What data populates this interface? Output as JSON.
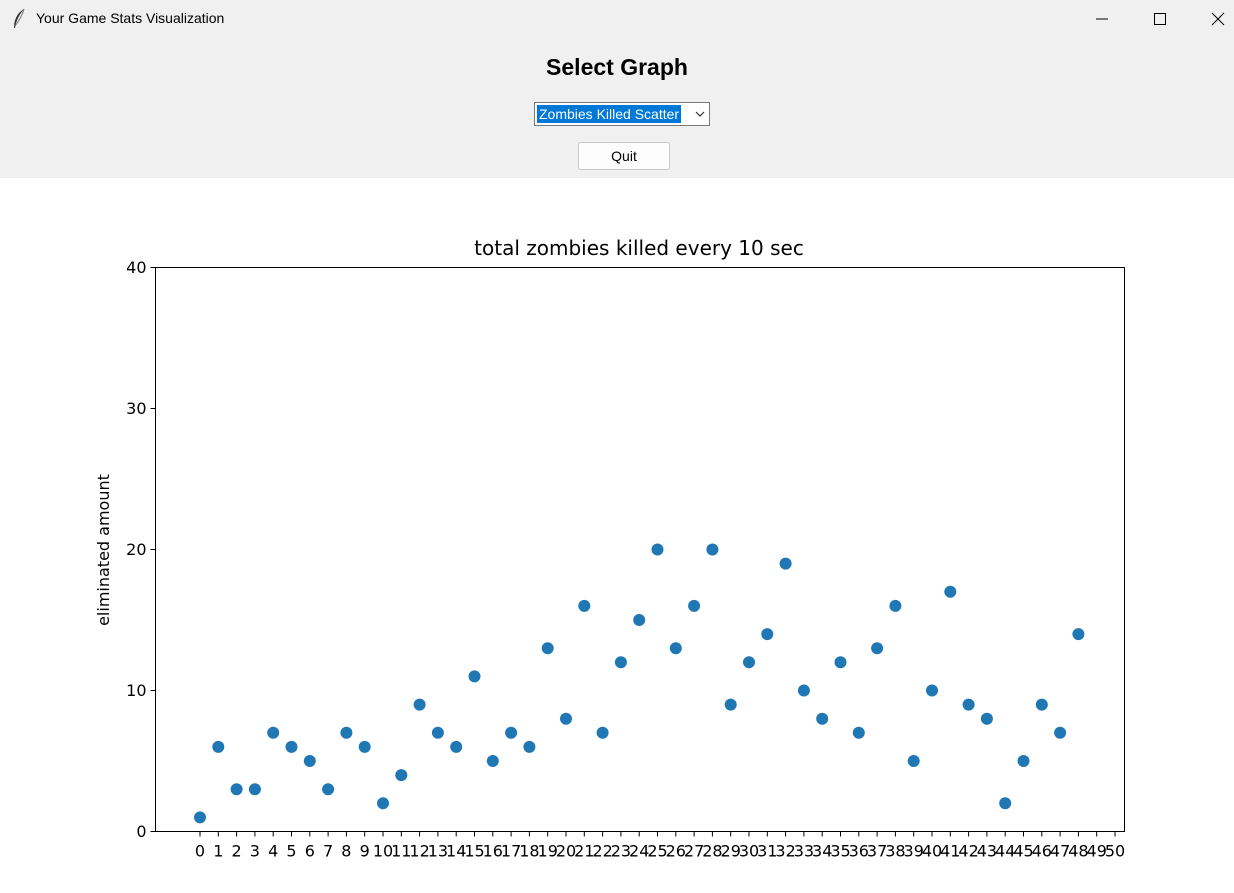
{
  "window": {
    "title": "Your Game Stats Visualization"
  },
  "controls": {
    "heading": "Select Graph",
    "graph_select": {
      "value": "Zombies Killed Scatter"
    },
    "quit_label": "Quit"
  },
  "colors": {
    "marker": "#1f77b4",
    "panel_bg": "#f0f0f0",
    "select_highlight": "#0078d7"
  },
  "chart_data": {
    "type": "scatter",
    "title": "total zombies killed every 10 sec",
    "xlabel": "",
    "ylabel": "eliminated amount",
    "x": [
      0,
      1,
      2,
      3,
      4,
      5,
      6,
      7,
      8,
      9,
      10,
      11,
      12,
      13,
      14,
      15,
      16,
      17,
      18,
      19,
      20,
      21,
      22,
      23,
      24,
      25,
      26,
      27,
      28,
      29,
      30,
      31,
      32,
      33,
      34,
      35,
      36,
      37,
      38,
      39,
      40,
      41,
      42,
      43,
      44,
      45,
      46,
      47,
      48
    ],
    "y": [
      1,
      6,
      3,
      3,
      7,
      6,
      5,
      3,
      7,
      6,
      2,
      4,
      9,
      7,
      6,
      11,
      5,
      7,
      6,
      13,
      8,
      16,
      7,
      12,
      15,
      20,
      13,
      16,
      20,
      9,
      12,
      14,
      19,
      10,
      8,
      12,
      7,
      13,
      16,
      5,
      10,
      17,
      9,
      8,
      2,
      5,
      9,
      7,
      14
    ],
    "xticks": [
      0,
      1,
      2,
      3,
      4,
      5,
      6,
      7,
      8,
      9,
      10,
      11,
      12,
      13,
      14,
      15,
      16,
      17,
      18,
      19,
      20,
      21,
      22,
      23,
      24,
      25,
      26,
      27,
      28,
      29,
      30,
      31,
      32,
      33,
      34,
      35,
      36,
      37,
      38,
      39,
      40,
      41,
      42,
      43,
      44,
      45,
      46,
      47,
      48,
      49,
      50
    ],
    "yticks": [
      0,
      10,
      20,
      30,
      40
    ],
    "ylim": [
      0,
      40
    ],
    "grid": false
  }
}
